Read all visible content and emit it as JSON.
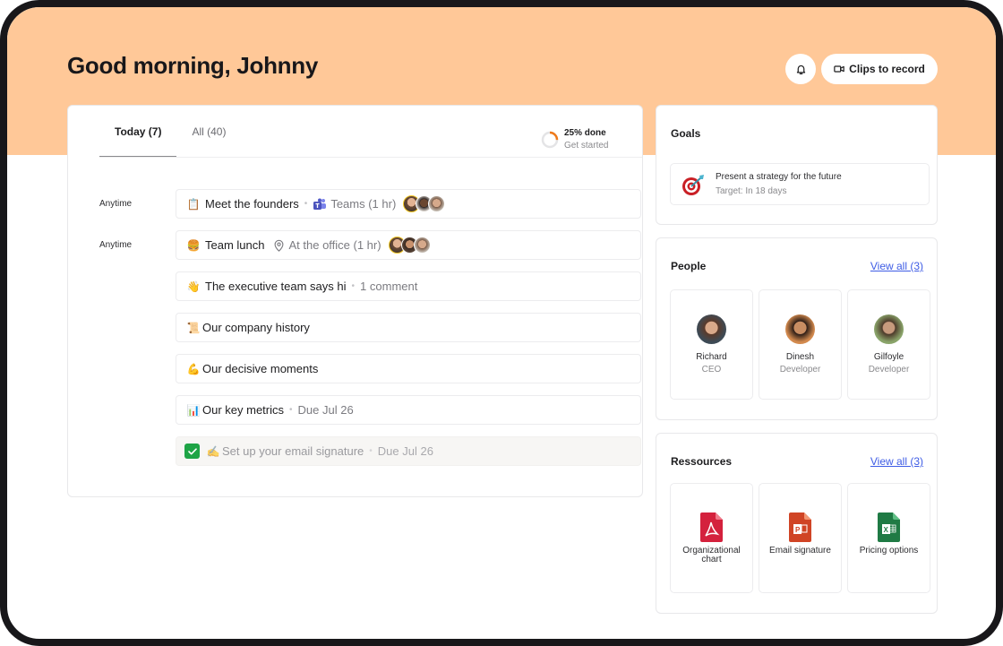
{
  "header": {
    "greeting": "Good morning, Johnny",
    "notifications_icon": "bell-icon",
    "clips_button": {
      "label": "Clips to record",
      "icon": "video-camera-icon"
    }
  },
  "colors": {
    "hero_background": "#ffc898",
    "frame": "#18171a",
    "accent_link": "#3e5ce5",
    "progress": "#ef7a1a",
    "checkbox": "#1ea446"
  },
  "tasks_panel": {
    "tabs": [
      {
        "label": "Today (7)",
        "active": true
      },
      {
        "label": "All (40)",
        "active": false
      }
    ],
    "progress": {
      "percent": 25,
      "label": "25% done",
      "sublabel": "Get started"
    },
    "tasks": [
      {
        "time": "Anytime",
        "emoji": "📋",
        "title": "Meet the founders",
        "meta_icon": "microsoft-teams-icon",
        "meta": "Teams (1 hr)",
        "attendees": 3,
        "done": false
      },
      {
        "time": "Anytime",
        "emoji": "🍔",
        "title": "Team lunch",
        "meta_icon": "location-pin-icon",
        "meta": "At the office (1 hr)",
        "attendees": 3,
        "done": false
      },
      {
        "time": "",
        "emoji": "👋",
        "title": "The executive team says hi",
        "meta": "1 comment",
        "done": false
      },
      {
        "time": "",
        "emoji": "📜",
        "title": "Our company history",
        "done": false
      },
      {
        "time": "",
        "emoji": "💪",
        "title": "Our decisive moments",
        "done": false
      },
      {
        "time": "",
        "emoji": "📊",
        "title": "Our key metrics",
        "meta": "Due Jul 26",
        "done": false
      },
      {
        "time": "",
        "emoji": "✍️",
        "title": "Set up your email signature",
        "meta": "Due Jul 26",
        "done": true
      }
    ]
  },
  "goals": {
    "title": "Goals",
    "items": [
      {
        "icon": "target-dart-icon",
        "name": "Present a strategy for the future",
        "target": "Target: In 18 days"
      }
    ]
  },
  "people": {
    "title": "People",
    "view_all": "View all (3)",
    "items": [
      {
        "name": "Richard",
        "role": "CEO"
      },
      {
        "name": "Dinesh",
        "role": "Developer"
      },
      {
        "name": "Gilfoyle",
        "role": "Developer"
      }
    ]
  },
  "resources": {
    "title": "Ressources",
    "view_all": "View all (3)",
    "items": [
      {
        "name": "Organizational chart",
        "type": "pdf",
        "icon": "pdf-file-icon"
      },
      {
        "name": "Email signature",
        "type": "powerpoint",
        "icon": "powerpoint-file-icon"
      },
      {
        "name": "Pricing options",
        "type": "excel",
        "icon": "excel-file-icon"
      }
    ]
  }
}
